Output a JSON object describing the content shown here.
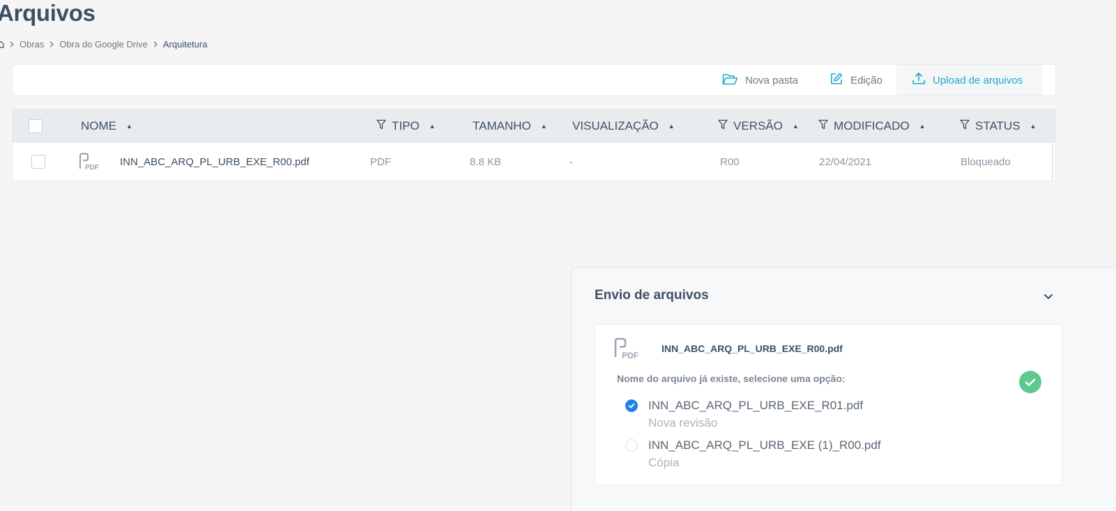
{
  "page": {
    "title": "Arquivos"
  },
  "breadcrumb": {
    "items": [
      "Obras",
      "Obra do Google Drive",
      "Arquitetura"
    ]
  },
  "toolbar": {
    "new_folder_label": "Nova pasta",
    "edit_label": "Edição",
    "upload_label": "Upload de arquivos"
  },
  "table": {
    "columns": [
      "NOME",
      "TIPO",
      "TAMANHO",
      "VISUALIZAÇÃO",
      "VERSÃO",
      "MODIFICADO",
      "STATUS"
    ],
    "rows": [
      {
        "name": "INN_ABC_ARQ_PL_URB_EXE_R00.pdf",
        "type": "PDF",
        "size": "8.8 KB",
        "preview": "-",
        "version": "R00",
        "modified": "22/04/2021",
        "status": "Bloqueado"
      }
    ]
  },
  "upload_panel": {
    "title": "Envio de arquivos",
    "file": {
      "name": "INN_ABC_ARQ_PL_URB_EXE_R00.pdf",
      "message": "Nome do arquivo já existe, selecione uma opção:",
      "options": [
        {
          "name": "INN_ABC_ARQ_PL_URB_EXE_R01.pdf",
          "sub": "Nova revisão",
          "selected": true
        },
        {
          "name": "INN_ABC_ARQ_PL_URB_EXE (1)_R00.pdf",
          "sub": "Cópia",
          "selected": false
        }
      ]
    }
  },
  "icons": {
    "file_type": "PDF",
    "folder": "folder-open-icon",
    "edit": "edit-icon",
    "upload": "upload-icon",
    "filter": "filter-icon",
    "success": "check-circle-icon"
  },
  "colors": {
    "accent": "#1ca8c9",
    "radio_selected": "#1a82e8",
    "success": "#5cc98f",
    "header_bg": "#e9ecef"
  }
}
